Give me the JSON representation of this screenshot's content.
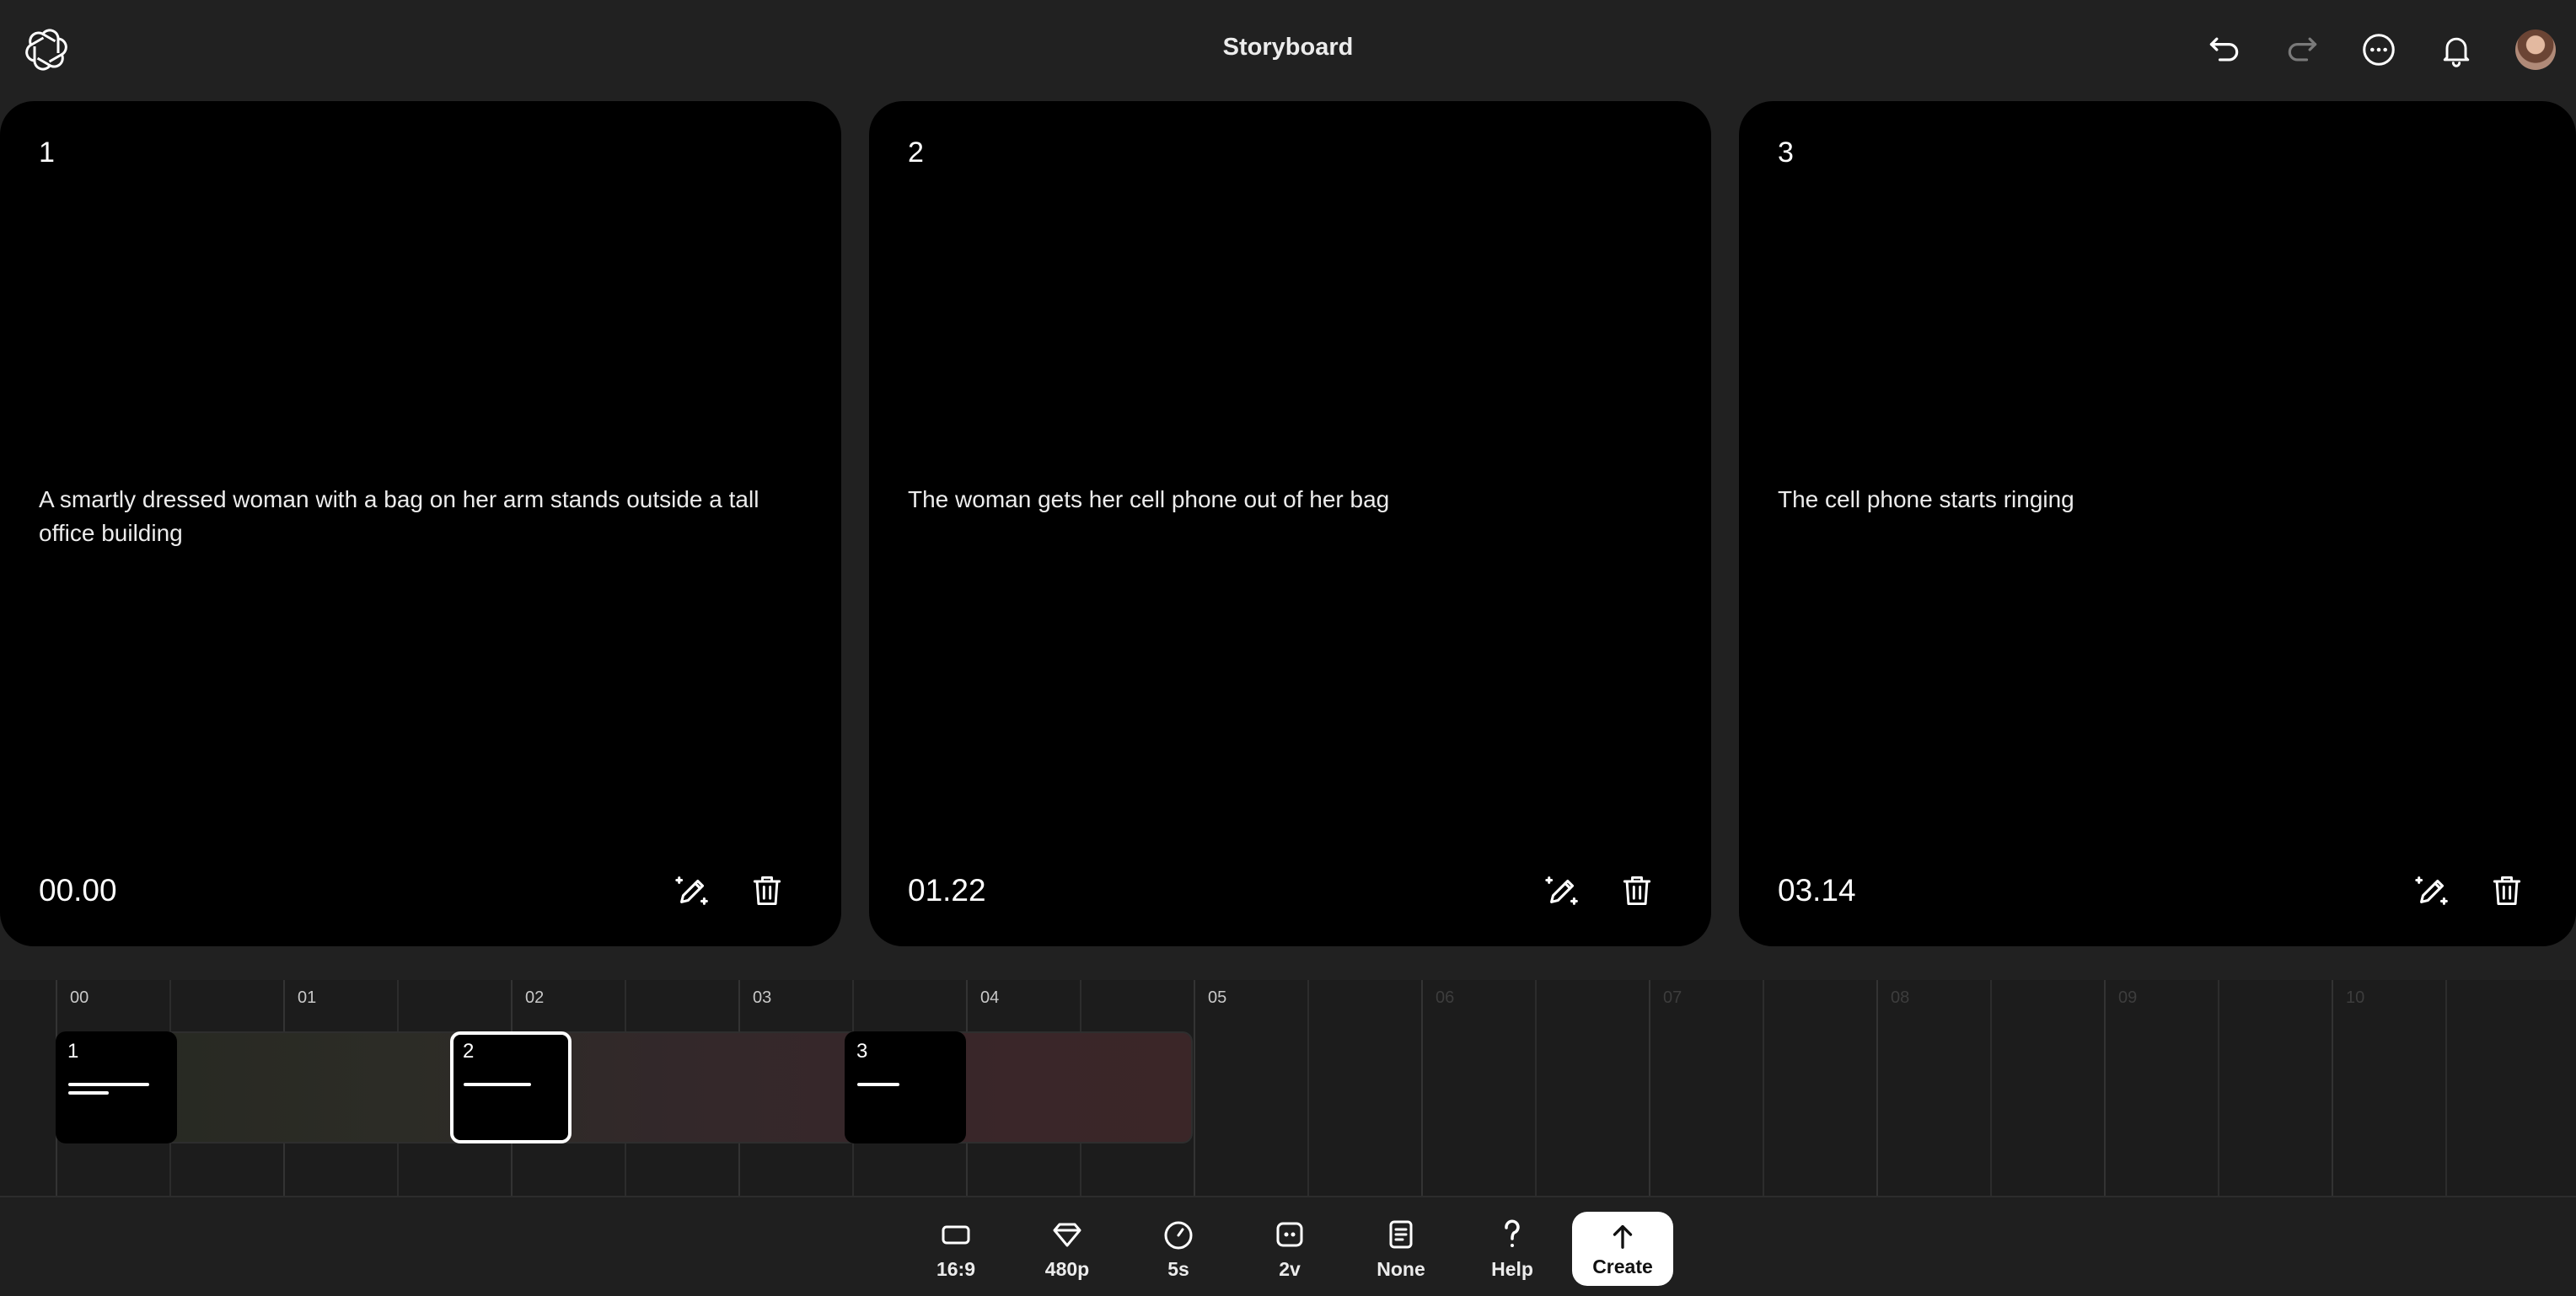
{
  "header": {
    "title": "Storyboard",
    "icons": [
      "openai-logo-icon",
      "undo-icon",
      "redo-icon",
      "more-icon",
      "bell-icon",
      "avatar"
    ]
  },
  "cards": [
    {
      "number": "1",
      "description": "A smartly dressed woman with a bag on her arm stands outside a tall office building",
      "time": "00.00"
    },
    {
      "number": "2",
      "description": "The woman gets her cell phone out of her bag",
      "time": "01.22"
    },
    {
      "number": "3",
      "description": "The cell phone starts ringing",
      "time": "03.14"
    }
  ],
  "timeline": {
    "labels": [
      "00",
      "01",
      "02",
      "03",
      "04",
      "05",
      "06",
      "07",
      "08",
      "09",
      "10"
    ],
    "clips": [
      {
        "number": "1",
        "selected": false
      },
      {
        "number": "2",
        "selected": true
      },
      {
        "number": "3",
        "selected": false
      }
    ]
  },
  "toolbar": {
    "aspect": "16:9",
    "resolution": "480p",
    "duration": "5s",
    "variations": "2v",
    "preset": "None",
    "help": "Help",
    "create": "Create"
  },
  "colors": {
    "background": "#212121",
    "card": "#000000",
    "timeline_bg": "#1c1c1c",
    "accent_button": "#ffffff"
  }
}
